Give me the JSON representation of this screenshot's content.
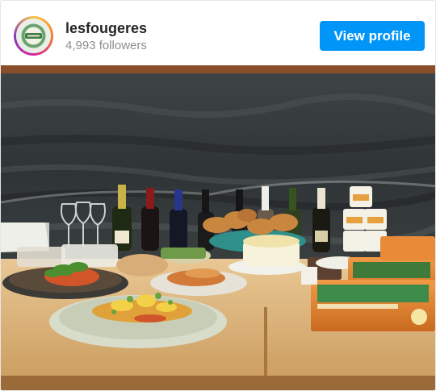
{
  "profile": {
    "username": "lesfougeres",
    "followers_text": "4,993 followers",
    "view_profile_label": "View profile"
  },
  "colors": {
    "accent": "#0095f6",
    "username": "#262626",
    "muted": "#8e8e8e"
  },
  "icons": {
    "avatar": "brand-logo-avatar"
  }
}
